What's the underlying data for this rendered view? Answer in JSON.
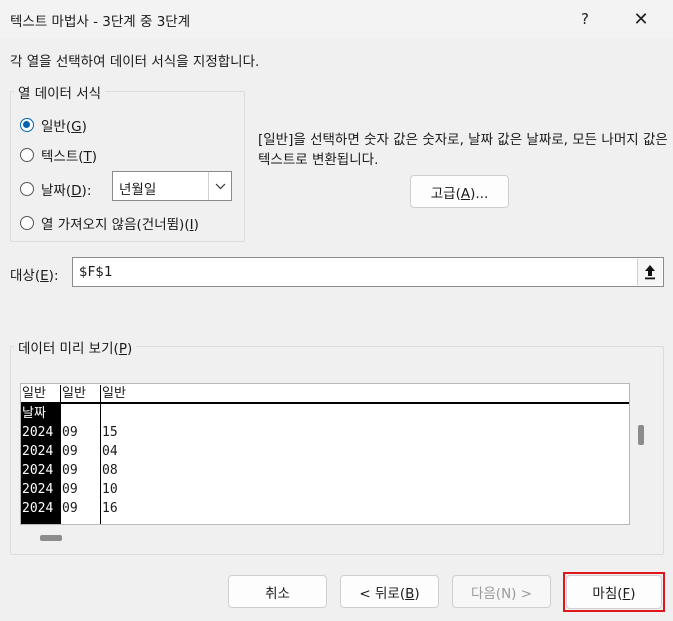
{
  "window": {
    "title": "텍스트 마법사 - 3단계 중 3단계",
    "help_label": "?",
    "close_label": "✕"
  },
  "instruction": "각 열을 선택하여 데이터 서식을 지정합니다.",
  "column_format": {
    "group_label": "열 데이터 서식",
    "options": [
      {
        "label": "일반",
        "hotkey": "G",
        "checked": true
      },
      {
        "label": "텍스트",
        "hotkey": "T",
        "checked": false
      },
      {
        "label": "날짜",
        "hotkey": "D",
        "suffix": ":",
        "checked": false
      },
      {
        "label": "열 가져오지 않음(건너뜀)",
        "hotkey": "I",
        "checked": false
      }
    ],
    "date_format_value": "년월일"
  },
  "description": "[일반]을 선택하면 숫자 값은 숫자로, 날짜 값은 날짜로, 모든 나머지 값은 텍스트로 변환됩니다.",
  "advanced_button": {
    "label": "고급",
    "hotkey": "A",
    "suffix": "..."
  },
  "destination": {
    "label": "대상",
    "hotkey": "E",
    "suffix": ":",
    "value": "$F$1"
  },
  "preview": {
    "group_label": "데이터 미리 보기",
    "hotkey": "P",
    "headers": [
      "일반",
      "일반",
      "일반"
    ],
    "columns": [
      [
        "날짜",
        "2024",
        "2024",
        "2024",
        "2024",
        "2024"
      ],
      [
        "",
        "09",
        "09",
        "09",
        "09",
        "09"
      ],
      [
        "",
        "15",
        "04",
        "08",
        "10",
        "16"
      ]
    ]
  },
  "footer": {
    "cancel": "취소",
    "back": {
      "label": "< 뒤로",
      "hotkey": "B"
    },
    "next": {
      "label": "다음",
      "hotkey": "N",
      "suffix": " >"
    },
    "finish": {
      "label": "마침",
      "hotkey": "F"
    }
  }
}
